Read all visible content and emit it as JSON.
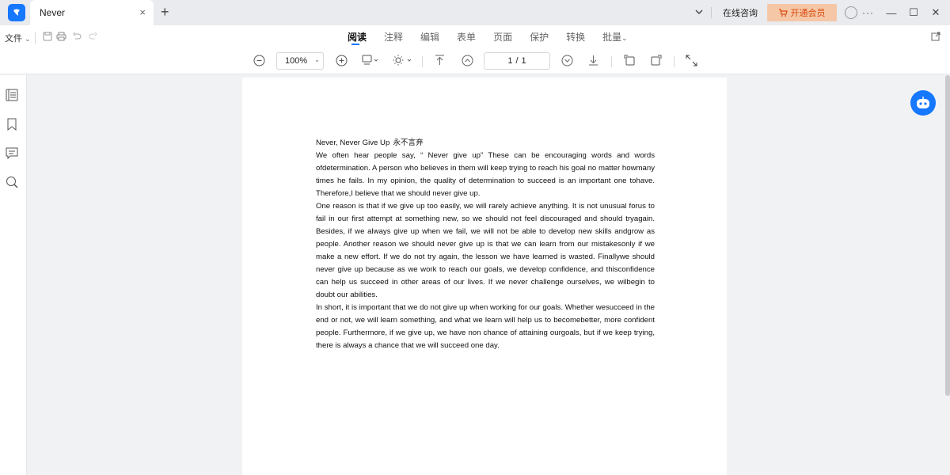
{
  "window": {
    "tab_title": "Never",
    "close_tab_glyph": "×",
    "new_tab_glyph": "+",
    "consult_label": "在线咨询",
    "vip_label": "开通会员",
    "more_glyph": "···",
    "minimize_glyph": "—",
    "maximize_glyph": "☐",
    "close_glyph": "✕"
  },
  "menubar": {
    "file_label": "文件",
    "file_caret": "⌄",
    "tabs": [
      {
        "label": "阅读"
      },
      {
        "label": "注释"
      },
      {
        "label": "编辑"
      },
      {
        "label": "表单"
      },
      {
        "label": "页面"
      },
      {
        "label": "保护"
      },
      {
        "label": "转换"
      },
      {
        "label": "批量"
      }
    ],
    "batch_caret": "⌄"
  },
  "toolbar": {
    "zoom_value": "100%",
    "zoom_caret": "⌄",
    "page_current": "1",
    "page_sep": "/",
    "page_total": "1",
    "icons": {
      "zoom_out": "zoom-out-icon",
      "zoom_in": "zoom-in-icon",
      "read_mode": "read-mode-icon",
      "brightness": "brightness-icon",
      "first_page": "first-page-icon",
      "prev_page": "prev-page-icon",
      "next_page": "next-page-icon",
      "last_page": "last-page-icon",
      "rotate_left": "rotate-left-icon",
      "rotate_right": "rotate-right-icon",
      "fullscreen": "fullscreen-icon"
    }
  },
  "document": {
    "title": "Never, Never Give Up",
    "title_cn": "永不言弃",
    "paragraphs": [
      "We often hear people say, “ Never give up” These can be encouraging words and words ofdetermination. A person who believes in them will keep trying to reach his goal no matter howmany times he fails. In my opinion, the quality of determination to succeed is an important one tohave. Therefore,I believe that we should never give up.",
      "One reason is that if we give up too easily, we will rarely achieve anything. It is not unusual forus to fail in our first attempt at something new, so we should not feel discouraged and should tryagain. Besides, if we always give up when we fail, we will not be able to develop new skills andgrow as people. Another reason we should never give up is that we can learn from our mistakesonly if we make a new effort. If we do not try again, the lesson we have learned is wasted. Finallywe should never give up because as we work to reach our goals, we develop confidence, and thisconfidence can help us succeed in other areas of our lives. If we never challenge ourselves, we wilbegin to doubt our abilities.",
      "In short, it is important that we do not give up when working for our goals. Whether wesucceed in the end or not, we will learn something, and what we learn will help us to becomebetter, more confident people. Furthermore, if we give up, we have non chance of attaining ourgoals, but if we keep trying, there is always a chance that we will succeed one day."
    ]
  },
  "colors": {
    "accent": "#1677ff",
    "vip_bg": "#f5c7a6",
    "vip_text": "#d9480f",
    "titlebar_bg": "#e9ebee",
    "canvas_bg": "#f1f2f4"
  }
}
